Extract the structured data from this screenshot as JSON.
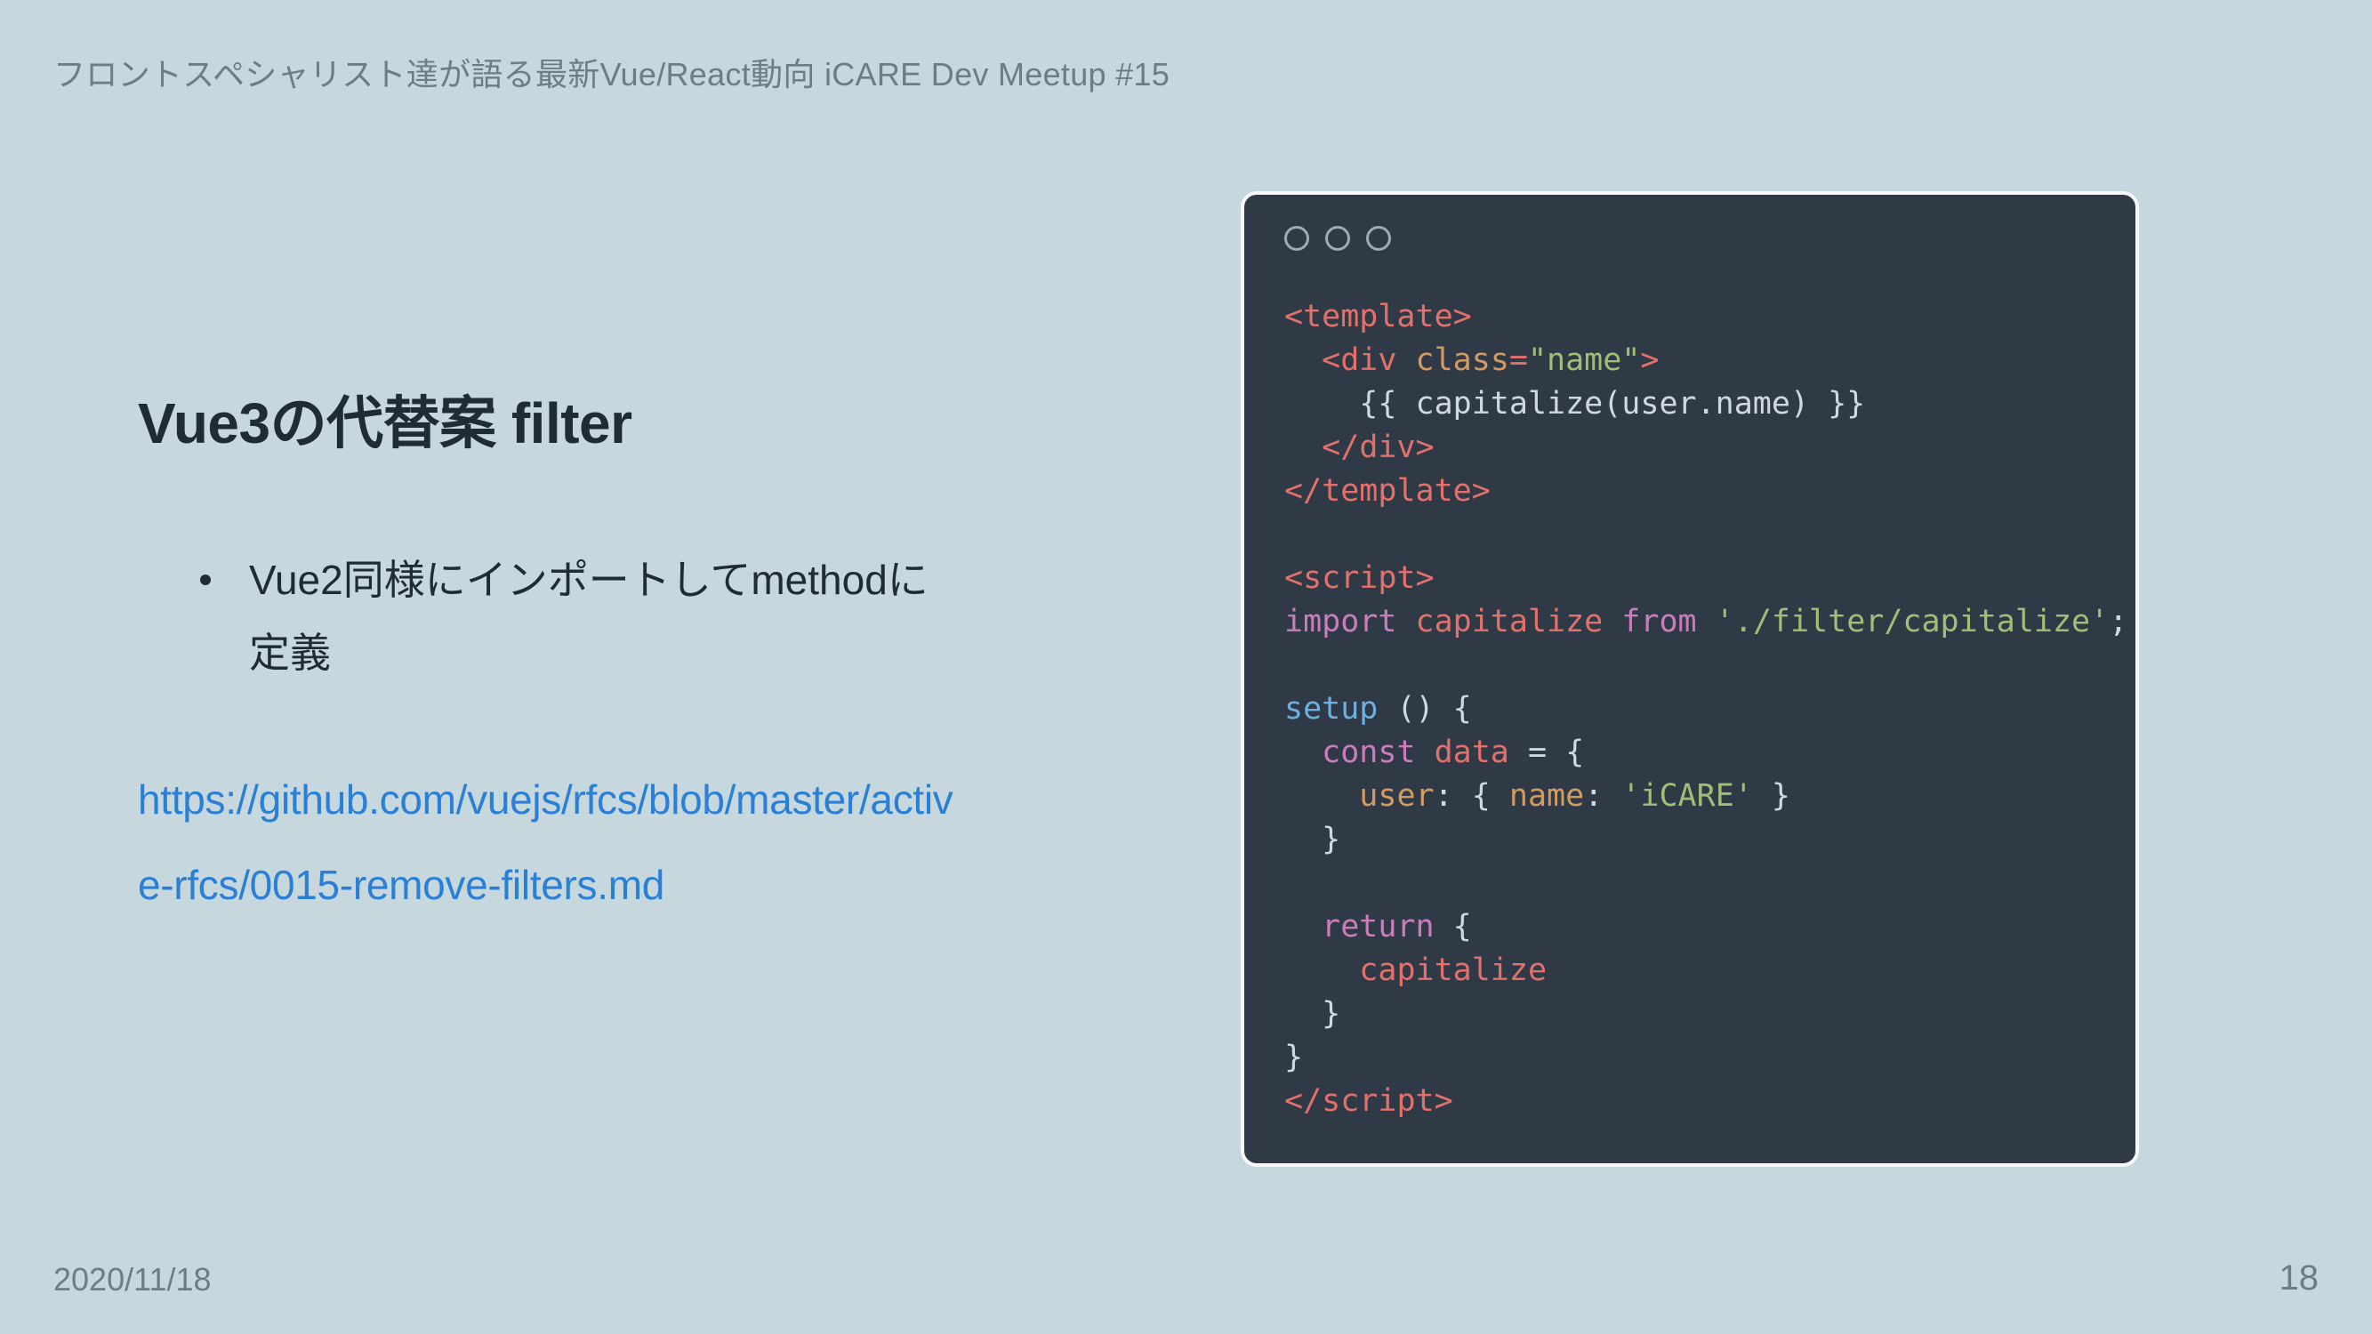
{
  "header": "フロントスペシャリスト達が語る最新Vue/React動向 iCARE Dev Meetup #15",
  "title": "Vue3の代替案 filter",
  "bullets": [
    "Vue2同様にインポートしてmethodに定義"
  ],
  "link_text": "https://github.com/vuejs/rfcs/blob/master/active-rfcs/0015-remove-filters.md",
  "footer": {
    "date": "2020/11/18",
    "page": "18"
  },
  "code": {
    "l1_open_tag": "template",
    "l2_open_tag": "div",
    "l2_attr": "class",
    "l2_attr_val": "\"name\"",
    "l3_text": "{{ capitalize(user.name) }}",
    "l4_close_tag": "div",
    "l5_close_tag": "template",
    "l7_open_tag": "script",
    "l8_import": "import",
    "l8_name": "capitalize",
    "l8_from": "from",
    "l8_path": "'./filter/capitalize'",
    "l8_semi": ";",
    "l10_fn": "setup",
    "l10_parens": " () {",
    "l11_const": "const",
    "l11_ident": "data",
    "l11_eq": " = {",
    "l12_key1": "user",
    "l12_sep1": ": { ",
    "l12_key2": "name",
    "l12_sep2": ": ",
    "l12_val": "'iCARE'",
    "l12_end": " }",
    "l13_brace": "}",
    "l15_return": "return",
    "l15_brace": " {",
    "l16_name": "capitalize",
    "l17_brace": "}",
    "l18_brace": "}",
    "l19_close_tag": "script"
  }
}
